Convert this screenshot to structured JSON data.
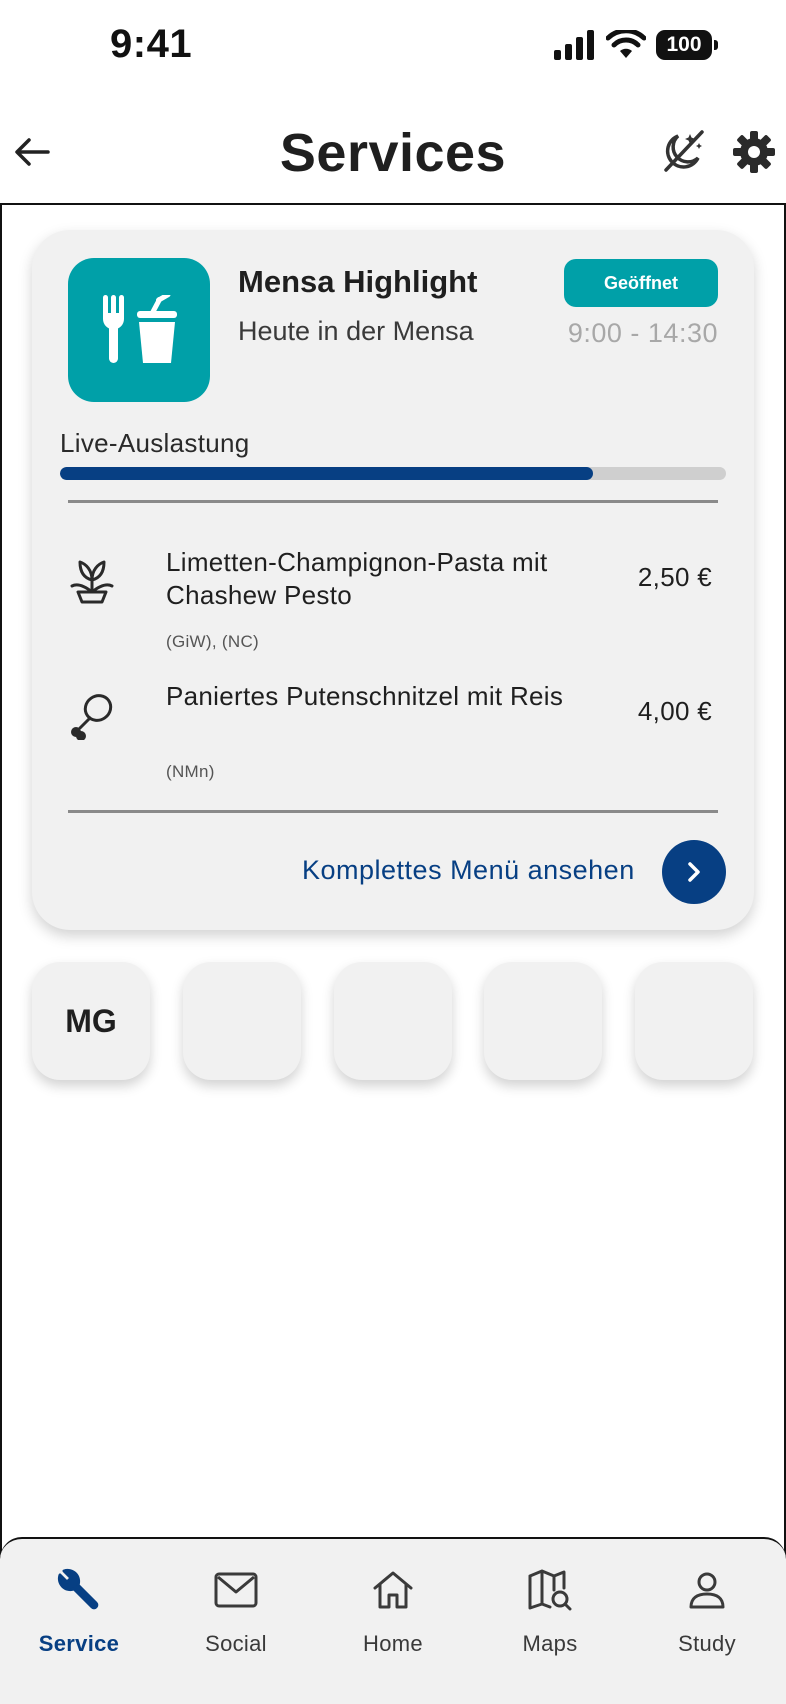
{
  "status_bar": {
    "time": "9:41",
    "battery": "100"
  },
  "header": {
    "title": "Services"
  },
  "mensa_card": {
    "title": "Mensa Highlight",
    "subtitle": "Heute in der Mensa",
    "status_badge": "Geöffnet",
    "hours": "9:00 - 14:30",
    "load_label": "Live-Auslastung",
    "load_fraction": 0.8,
    "dishes": [
      {
        "icon": "sprout-icon",
        "name": "Limetten-Champignon-Pasta mit Chashew Pesto",
        "tags": "(GiW), (NC)",
        "price": "2,50 €"
      },
      {
        "icon": "drumstick-icon",
        "name": "Paniertes Putenschnitzel mit Reis",
        "tags": "(NMn)",
        "price": "4,00 €"
      }
    ],
    "menu_link": "Komplettes Menü ansehen"
  },
  "quick_tiles": [
    {
      "label": "MG"
    },
    {
      "label": ""
    },
    {
      "label": ""
    },
    {
      "label": ""
    },
    {
      "label": ""
    }
  ],
  "bottom_nav": [
    {
      "label": "Service",
      "icon": "wrench-icon",
      "active": true
    },
    {
      "label": "Social",
      "icon": "mail-icon",
      "active": false
    },
    {
      "label": "Home",
      "icon": "home-icon",
      "active": false
    },
    {
      "label": "Maps",
      "icon": "map-search-icon",
      "active": false
    },
    {
      "label": "Study",
      "icon": "person-icon",
      "active": false
    }
  ],
  "colors": {
    "accent_teal": "#00a0a8",
    "accent_blue": "#073f83",
    "card_bg": "#f1f1f1"
  }
}
